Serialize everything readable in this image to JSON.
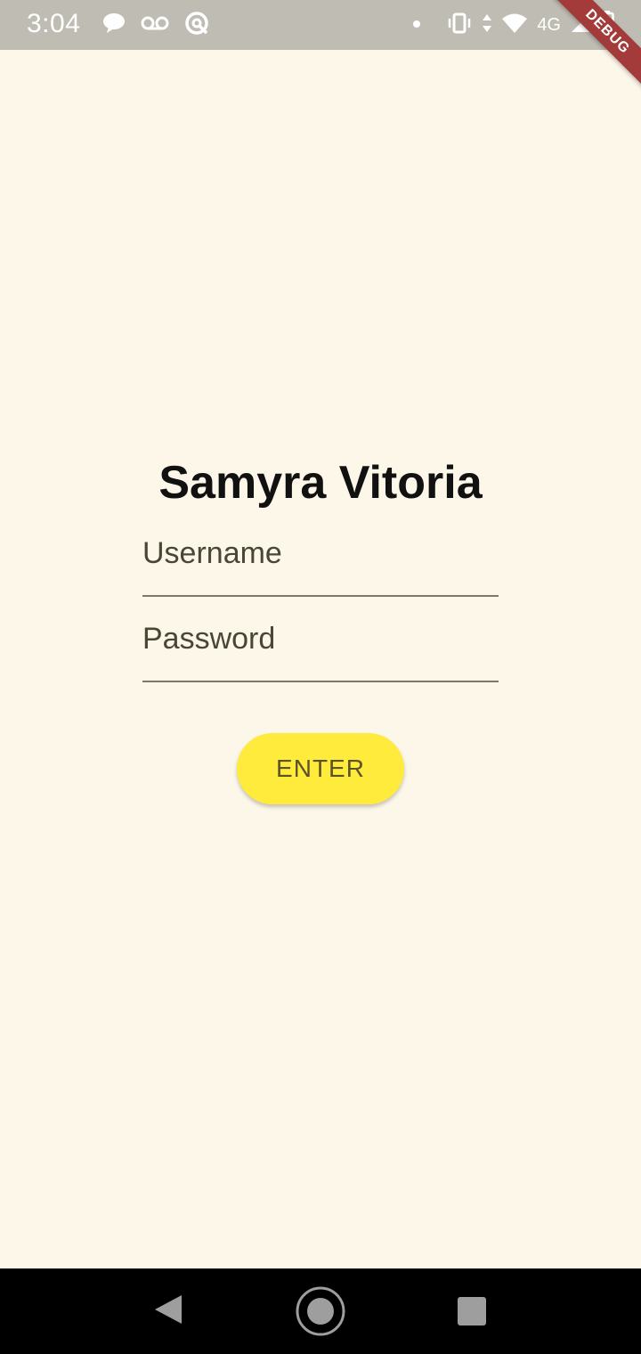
{
  "status_bar": {
    "time": "3:04",
    "network_label": "4G",
    "left_icons": [
      "chat-bubble-icon",
      "voicemail-icon",
      "sync-icon"
    ],
    "right_icons": [
      "dot-icon",
      "vibrate-icon",
      "data-arrows-icon",
      "wifi-icon",
      "signal-icon",
      "battery-icon"
    ]
  },
  "debug_banner": "DEBUG",
  "app": {
    "title": "Samyra Vitoria",
    "username_placeholder": "Username",
    "password_placeholder": "Password",
    "enter_label": "ENTER"
  },
  "colors": {
    "background": "#fdf7e9",
    "button": "#ffeb3b",
    "button_text": "#5b5326",
    "status_bar": "#bfbcb3",
    "debug_banner": "#a33b3b"
  },
  "nav_bar": {
    "buttons": [
      "back-icon",
      "home-icon",
      "recents-icon"
    ]
  }
}
